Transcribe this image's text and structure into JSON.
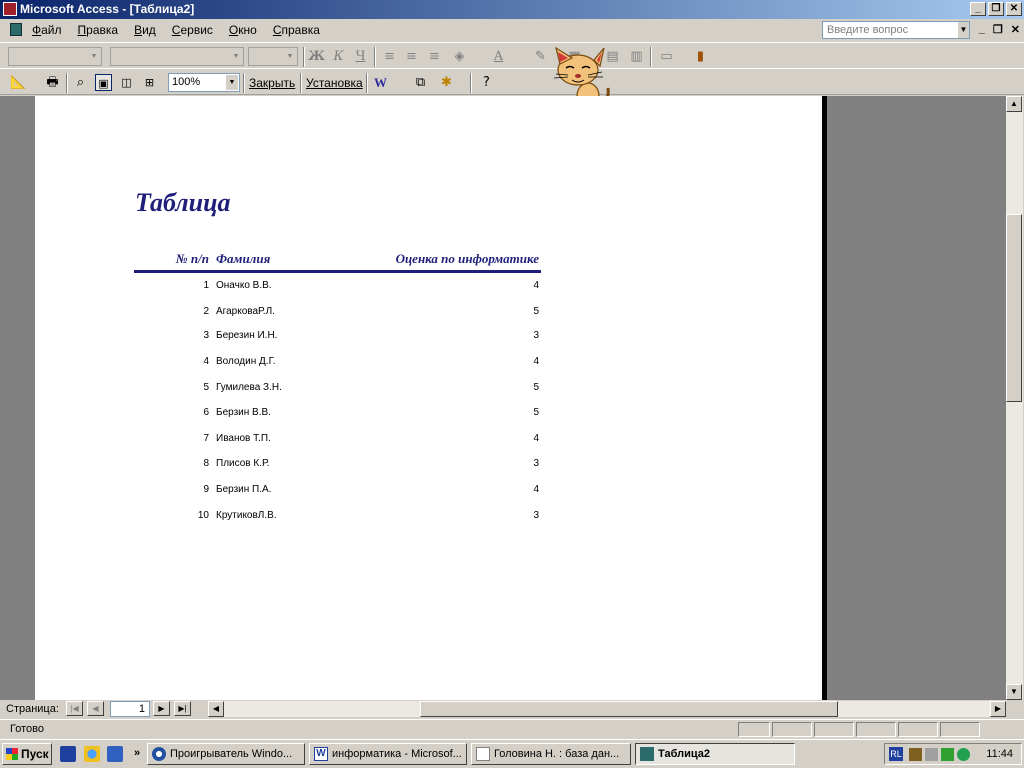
{
  "window": {
    "title": "Microsoft Access - [Таблица2]"
  },
  "menu": {
    "items": [
      "Файл",
      "Правка",
      "Вид",
      "Сервис",
      "Окно",
      "Справка"
    ]
  },
  "help_box": {
    "placeholder": "Введите вопрос"
  },
  "toolbar": {
    "zoom": "100%",
    "close_label": "Закрыть",
    "setup_label": "Установка",
    "bold": "Ж",
    "italic": "К",
    "underline": "Ч"
  },
  "report": {
    "title": "Таблица",
    "columns": [
      "№ п/п",
      "Фамилия",
      "Оценка по информатике"
    ],
    "rows": [
      {
        "num": "1",
        "name": "Оначко В.В.",
        "grade": "4"
      },
      {
        "num": "2",
        "name": "АгарковаР.Л.",
        "grade": "5"
      },
      {
        "num": "3",
        "name": "Березин И.Н.",
        "grade": "3"
      },
      {
        "num": "4",
        "name": "Володин Д.Г.",
        "grade": "4"
      },
      {
        "num": "5",
        "name": "Гумилева З.Н.",
        "grade": "5"
      },
      {
        "num": "6",
        "name": "Берзин В.В.",
        "grade": "5"
      },
      {
        "num": "7",
        "name": "Иванов Т.П.",
        "grade": "4"
      },
      {
        "num": "8",
        "name": "Плисов К.Р.",
        "grade": "3"
      },
      {
        "num": "9",
        "name": "Берзин П.А.",
        "grade": "4"
      },
      {
        "num": "10",
        "name": "КрутиковЛ.В.",
        "grade": "3"
      }
    ]
  },
  "navigation": {
    "label": "Страница:",
    "page": "1"
  },
  "status": {
    "text": "Готово"
  },
  "taskbar": {
    "start": "Пуск",
    "tasks": [
      "Проигрыватель Windo...",
      "информатика - Microsof...",
      "Головина Н. : база дан...",
      "Таблица2"
    ],
    "tray_lang": "RL",
    "clock": "11:44"
  },
  "colors": {
    "title_gradient_start": "#0a246a",
    "report_text": "#1f1f7a"
  }
}
